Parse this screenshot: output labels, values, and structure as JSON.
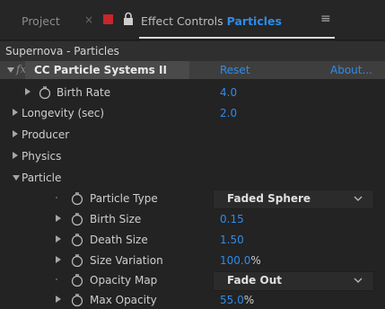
{
  "tabs": {
    "project_label": "Project",
    "close_glyph": "×",
    "effect_controls_prefix": "Effect Controls",
    "effect_controls_layer": "Particles",
    "menu_glyph": "≡"
  },
  "header": {
    "title": "Supernova - Particles"
  },
  "effect": {
    "fx_glyph": "fx",
    "name": "CC Particle Systems II",
    "reset_label": "Reset",
    "about_label": "About..."
  },
  "props": {
    "birth_rate": {
      "label": "Birth Rate",
      "value": "4.0"
    },
    "longevity": {
      "label": "Longevity (sec)",
      "value": "2.0"
    },
    "producer": {
      "label": "Producer"
    },
    "physics": {
      "label": "Physics"
    },
    "particle": {
      "label": "Particle"
    },
    "particle_type": {
      "label": "Particle Type",
      "value": "Faded Sphere"
    },
    "birth_size": {
      "label": "Birth Size",
      "value": "0.15"
    },
    "death_size": {
      "label": "Death Size",
      "value": "1.50"
    },
    "size_variation": {
      "label": "Size Variation",
      "value": "100.0",
      "unit": "%"
    },
    "opacity_map": {
      "label": "Opacity Map",
      "value": "Fade Out"
    },
    "max_opacity": {
      "label": "Max Opacity",
      "value": "55.0",
      "unit": "%"
    }
  },
  "colors": {
    "accent": "#2d8ceb",
    "label_swatch": "#c8252c",
    "panel_bg": "#232323"
  },
  "icons": [
    "close-icon",
    "label-color-swatch",
    "lock-icon",
    "panel-menu-icon",
    "fx-icon",
    "stopwatch-icon",
    "disclosure-triangle-icon",
    "chevron-down-icon"
  ]
}
